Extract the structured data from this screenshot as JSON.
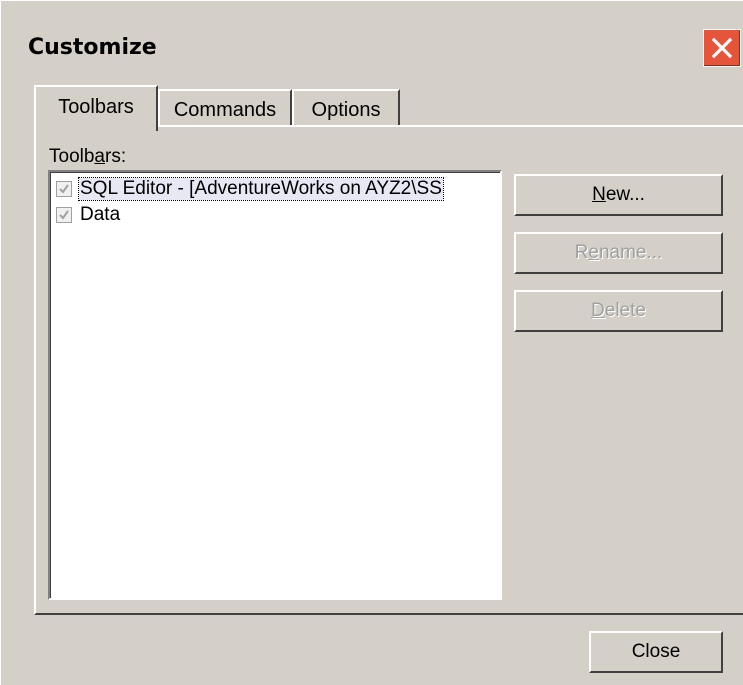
{
  "window": {
    "title": "Customize",
    "close_icon": "close-x-icon",
    "accent": "#e6553a",
    "background": "#d4d0c8"
  },
  "tabs": [
    {
      "label": "Toolbars",
      "active": true
    },
    {
      "label": "Commands",
      "active": false
    },
    {
      "label": "Options",
      "active": false
    }
  ],
  "toolbars_panel": {
    "list_label_pre": "Toolb",
    "list_label_u": "a",
    "list_label_post": "rs:",
    "items": [
      {
        "label": "SQL Editor - [AdventureWorks on AYZ2\\SS",
        "checked": true,
        "selected": true
      },
      {
        "label": "Data",
        "checked": true,
        "selected": false
      }
    ],
    "buttons": {
      "new": {
        "pre": "",
        "u": "N",
        "post": "ew...",
        "enabled": true
      },
      "rename": {
        "pre": "R",
        "u": "e",
        "post": "name...",
        "enabled": false
      },
      "delete": {
        "pre": "",
        "u": "D",
        "post": "elete",
        "enabled": false
      }
    }
  },
  "footer": {
    "close_label": "Close"
  }
}
